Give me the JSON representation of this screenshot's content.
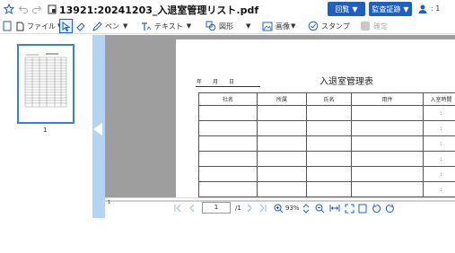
{
  "window": {
    "file_title": "13921:20241203_入退室管理リスト.pdf",
    "btn_reply": "回覧",
    "btn_approve": "監査証跡",
    "page_indicator": ": 1"
  },
  "toolbar": {
    "file_label": "ファイル",
    "pen_label": "ペン",
    "text_label": "テキスト",
    "shape_label": "図形",
    "image_label": "画像",
    "stamp_label": "スタンプ",
    "confirm_label": "確定"
  },
  "thumbnails": [
    {
      "page_number": "1"
    }
  ],
  "statusbar": {
    "current_page": "1",
    "total_pages": "/1",
    "zoom": "93%",
    "marker": "1"
  },
  "document": {
    "date_text": "年　　月　　日",
    "title": "入退室管理表",
    "columns": [
      "社名",
      "所属",
      "氏名",
      "用件",
      "入室時間"
    ],
    "time_cell": ":"
  },
  "colors": {
    "accent": "#1f5fbf",
    "sidebar_bar": "#b5d4f4",
    "viewer_bg": "#9e9e9e"
  }
}
